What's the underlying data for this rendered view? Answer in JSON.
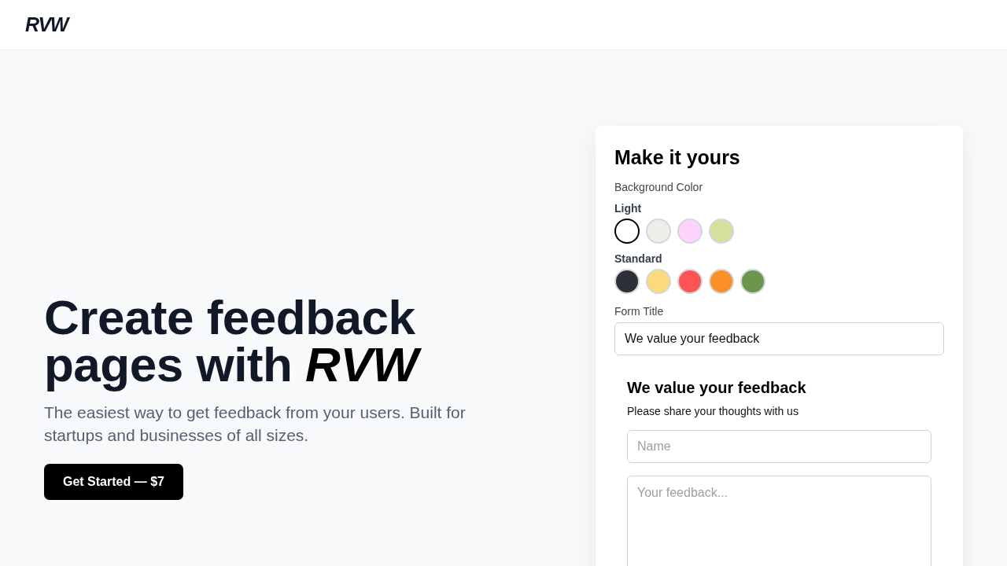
{
  "header": {
    "logo": "RVW"
  },
  "hero": {
    "headline": "Create feedback pages with *RVW*",
    "subtitle": "The easiest way to get feedback from your users. Built for startups and businesses of all sizes.",
    "cta": "Get Started — $7"
  },
  "customizer": {
    "title": "Make it yours",
    "background_label": "Background Color",
    "palettes": [
      {
        "label": "Light",
        "swatches": [
          {
            "color": "#ffffff",
            "selected": true
          },
          {
            "color": "#eeede8",
            "selected": false
          },
          {
            "color": "#fdd3fd",
            "selected": false
          },
          {
            "color": "#d6df9c",
            "selected": false
          }
        ]
      },
      {
        "label": "Standard",
        "swatches": [
          {
            "color": "#2d3036",
            "selected": false
          },
          {
            "color": "#fdd97c",
            "selected": false
          },
          {
            "color": "#fc5353",
            "selected": false
          },
          {
            "color": "#fb8f2a",
            "selected": false
          },
          {
            "color": "#6a974c",
            "selected": false
          }
        ]
      }
    ],
    "form_title_label": "Form Title",
    "form_title_value": "We value your feedback",
    "preview": {
      "title": "We value your feedback",
      "subtitle": "Please share your thoughts with us",
      "name_placeholder": "Name",
      "feedback_placeholder": "Your feedback..."
    }
  }
}
